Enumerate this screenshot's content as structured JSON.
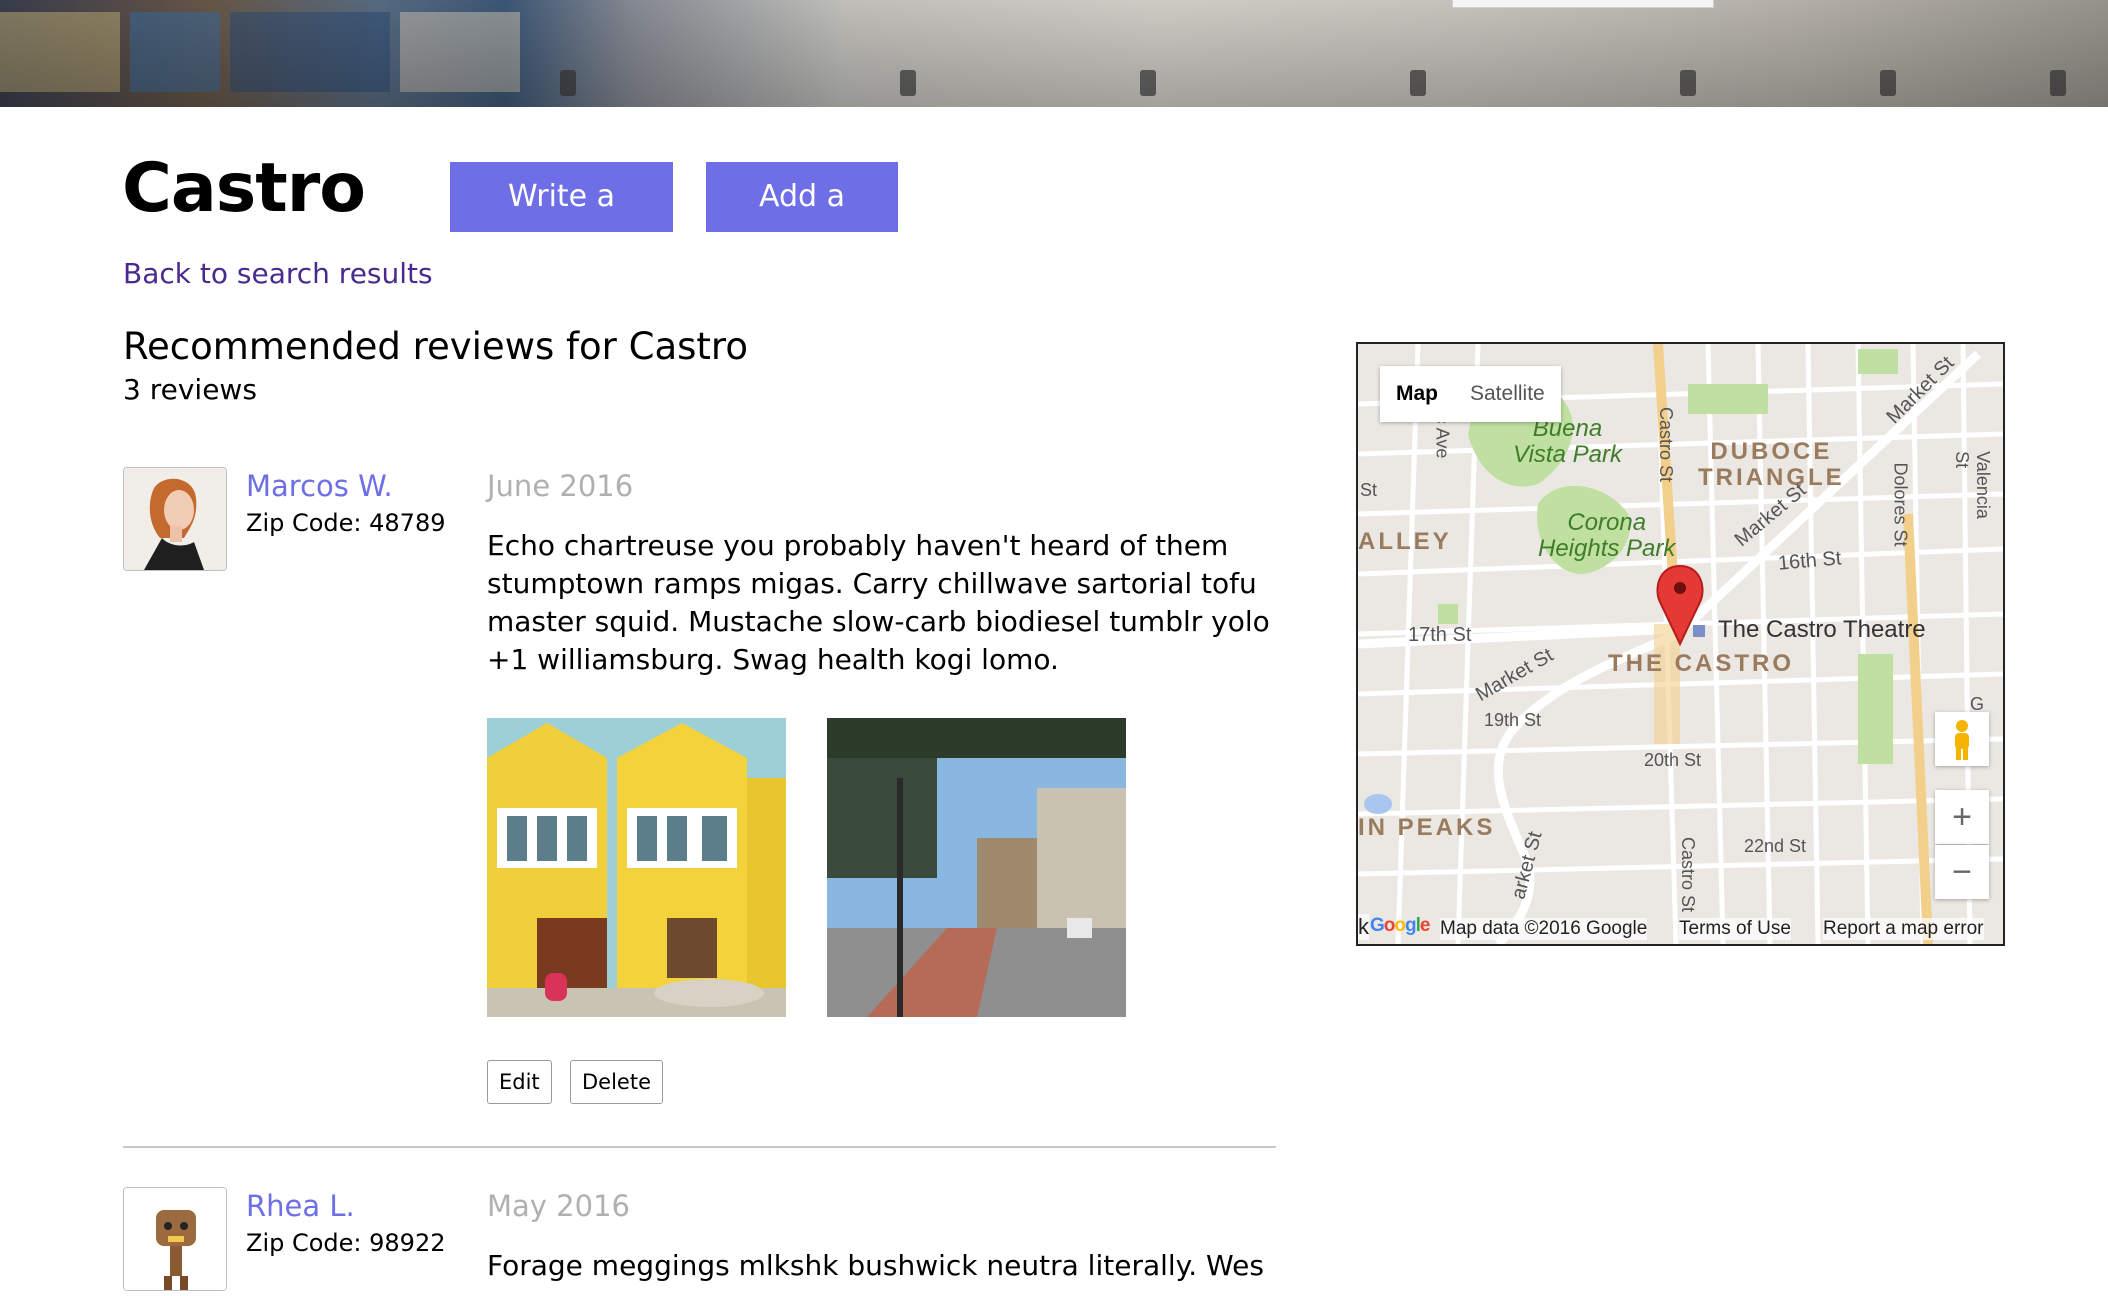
{
  "page": {
    "title": "Castro",
    "write_review_label": "Write a Review",
    "add_photo_label": "Add a Photo",
    "back_link": "Back to search results"
  },
  "reviews_section": {
    "heading": "Recommended reviews for Castro",
    "count": "3 reviews"
  },
  "reviews": [
    {
      "name": "Marcos W.",
      "zip": "Zip Code: 48789",
      "date": "June 2016",
      "text": "Echo chartreuse you probably haven't heard of them stumptown ramps migas. Carry chillwave sartorial tofu master squid. Mustache slow-carb biodiesel tumblr yolo +1 williamsburg. Swag health kogi lomo.",
      "edit_label": "Edit",
      "delete_label": "Delete"
    },
    {
      "name": "Rhea L.",
      "zip": "Zip Code: 98922",
      "date": "May 2016",
      "text": "Forage meggings mlkshk bushwick neutra literally. Wes"
    }
  ],
  "map": {
    "map_label": "Map",
    "satellite_label": "Satellite",
    "zoom_in": "+",
    "zoom_out": "−",
    "logo": "Google",
    "attribution": "Map data ©2016 Google",
    "terms": "Terms of Use",
    "report": "Report a map error",
    "labels": {
      "buena_vista_1": "Buena",
      "buena_vista_2": "Vista Park",
      "corona_1": "Corona",
      "corona_2": "Heights Park",
      "duboce_1": "DUBOCE",
      "duboce_2": "TRIANGLE",
      "valley": "ALLEY",
      "castro_theatre": "The Castro Theatre",
      "the_castro": "THE CASTRO",
      "st_17": "17th St",
      "st_16": "16th St",
      "st_19": "19th St",
      "st_20": "20th St",
      "st_22": "22nd St",
      "market_1": "Market St",
      "market_2": "Market St",
      "market_3": "Market St",
      "market_4": "arket St",
      "castro_st_1": "Castro St",
      "castro_st_2": "Castro St",
      "dolores_st": "Dolores St",
      "valencia_st": "Valencia St",
      "peaks": "IN PEAKS",
      "ic_ave": "ic Ave",
      "st_left": "St",
      "g_edge": "G",
      "k_left": "k"
    }
  },
  "colors": {
    "accent": "#6e6ee6",
    "link": "#4a2a8f",
    "date": "#b0b0b0",
    "map_park": "#bfe0a0",
    "pin": "#e53935"
  }
}
